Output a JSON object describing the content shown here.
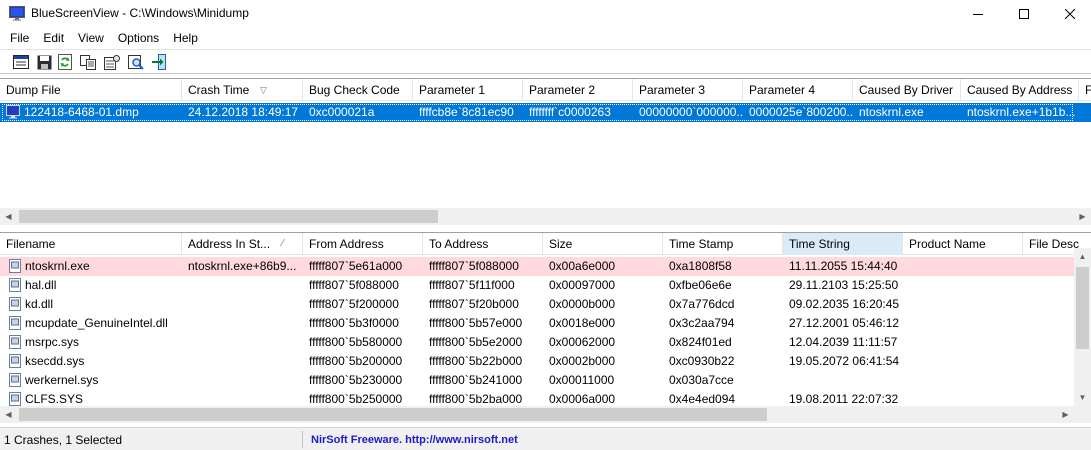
{
  "window": {
    "title": "BlueScreenView  -  C:\\Windows\\Minidump",
    "icon": "bluescreen-monitor-icon"
  },
  "menu": [
    "File",
    "Edit",
    "View",
    "Options",
    "Help"
  ],
  "toolbar": {
    "icons": [
      "properties-icon",
      "save-icon",
      "refresh-icon",
      "copy-icon",
      "html-report-icon",
      "find-icon",
      "exit-icon"
    ]
  },
  "crash_list": {
    "columns": [
      "Dump File",
      "Crash Time",
      "Bug Check Code",
      "Parameter 1",
      "Parameter 2",
      "Parameter 3",
      "Parameter 4",
      "Caused By Driver",
      "Caused By Address",
      "F"
    ],
    "sorted_column": "Crash Time",
    "rows": [
      {
        "selected": true,
        "cells": [
          "122418-6468-01.dmp",
          "24.12.2018 18:49:17",
          "0xc000021a",
          "ffffcb8e`8c81ec90",
          "ffffffff`c0000263",
          "00000000`000000...",
          "0000025e`800200...",
          "ntoskrnl.exe",
          "ntoskrnl.exe+1b1b..."
        ]
      }
    ]
  },
  "driver_list": {
    "columns": [
      "Filename",
      "Address In St...",
      "From Address",
      "To Address",
      "Size",
      "Time Stamp",
      "Time String",
      "Product Name",
      "File Desc"
    ],
    "sorted_column": "Time String",
    "rows": [
      {
        "highlight": true,
        "cells": [
          "ntoskrnl.exe",
          "ntoskrnl.exe+86b9...",
          "fffff807`5e61a000",
          "fffff807`5f088000",
          "0x00a6e000",
          "0xa1808f58",
          "11.11.2055 15:44:40",
          "",
          ""
        ]
      },
      {
        "highlight": false,
        "cells": [
          "hal.dll",
          "",
          "fffff807`5f088000",
          "fffff807`5f11f000",
          "0x00097000",
          "0xfbe06e6e",
          "29.11.2103 15:25:50",
          "",
          ""
        ]
      },
      {
        "highlight": false,
        "cells": [
          "kd.dll",
          "",
          "fffff807`5f200000",
          "fffff807`5f20b000",
          "0x0000b000",
          "0x7a776dcd",
          "09.02.2035 16:20:45",
          "",
          ""
        ]
      },
      {
        "highlight": false,
        "cells": [
          "mcupdate_GenuineIntel.dll",
          "",
          "fffff800`5b3f0000",
          "fffff800`5b57e000",
          "0x0018e000",
          "0x3c2aa794",
          "27.12.2001 05:46:12",
          "",
          ""
        ]
      },
      {
        "highlight": false,
        "cells": [
          "msrpc.sys",
          "",
          "fffff800`5b580000",
          "fffff800`5b5e2000",
          "0x00062000",
          "0x824f01ed",
          "12.04.2039 11:11:57",
          "",
          ""
        ]
      },
      {
        "highlight": false,
        "cells": [
          "ksecdd.sys",
          "",
          "fffff800`5b200000",
          "fffff800`5b22b000",
          "0x0002b000",
          "0xc0930b22",
          "19.05.2072 06:41:54",
          "",
          ""
        ]
      },
      {
        "highlight": false,
        "cells": [
          "werkernel.sys",
          "",
          "fffff800`5b230000",
          "fffff800`5b241000",
          "0x00011000",
          "0x030a7cce",
          "",
          "",
          ""
        ]
      },
      {
        "highlight": false,
        "cells": [
          "CLFS.SYS",
          "",
          "fffff800`5b250000",
          "fffff800`5b2ba000",
          "0x0006a000",
          "0x4e4ed094",
          "19.08.2011 22:07:32",
          "",
          ""
        ]
      }
    ]
  },
  "status": {
    "summary": "1 Crashes, 1 Selected",
    "link": "NirSoft Freeware.  http://www.nirsoft.net"
  },
  "colors": {
    "selection": "#0078d7",
    "highlight_row": "#ffd9de",
    "sorted_header": "#d9ebf9",
    "link": "#1a1acd"
  }
}
